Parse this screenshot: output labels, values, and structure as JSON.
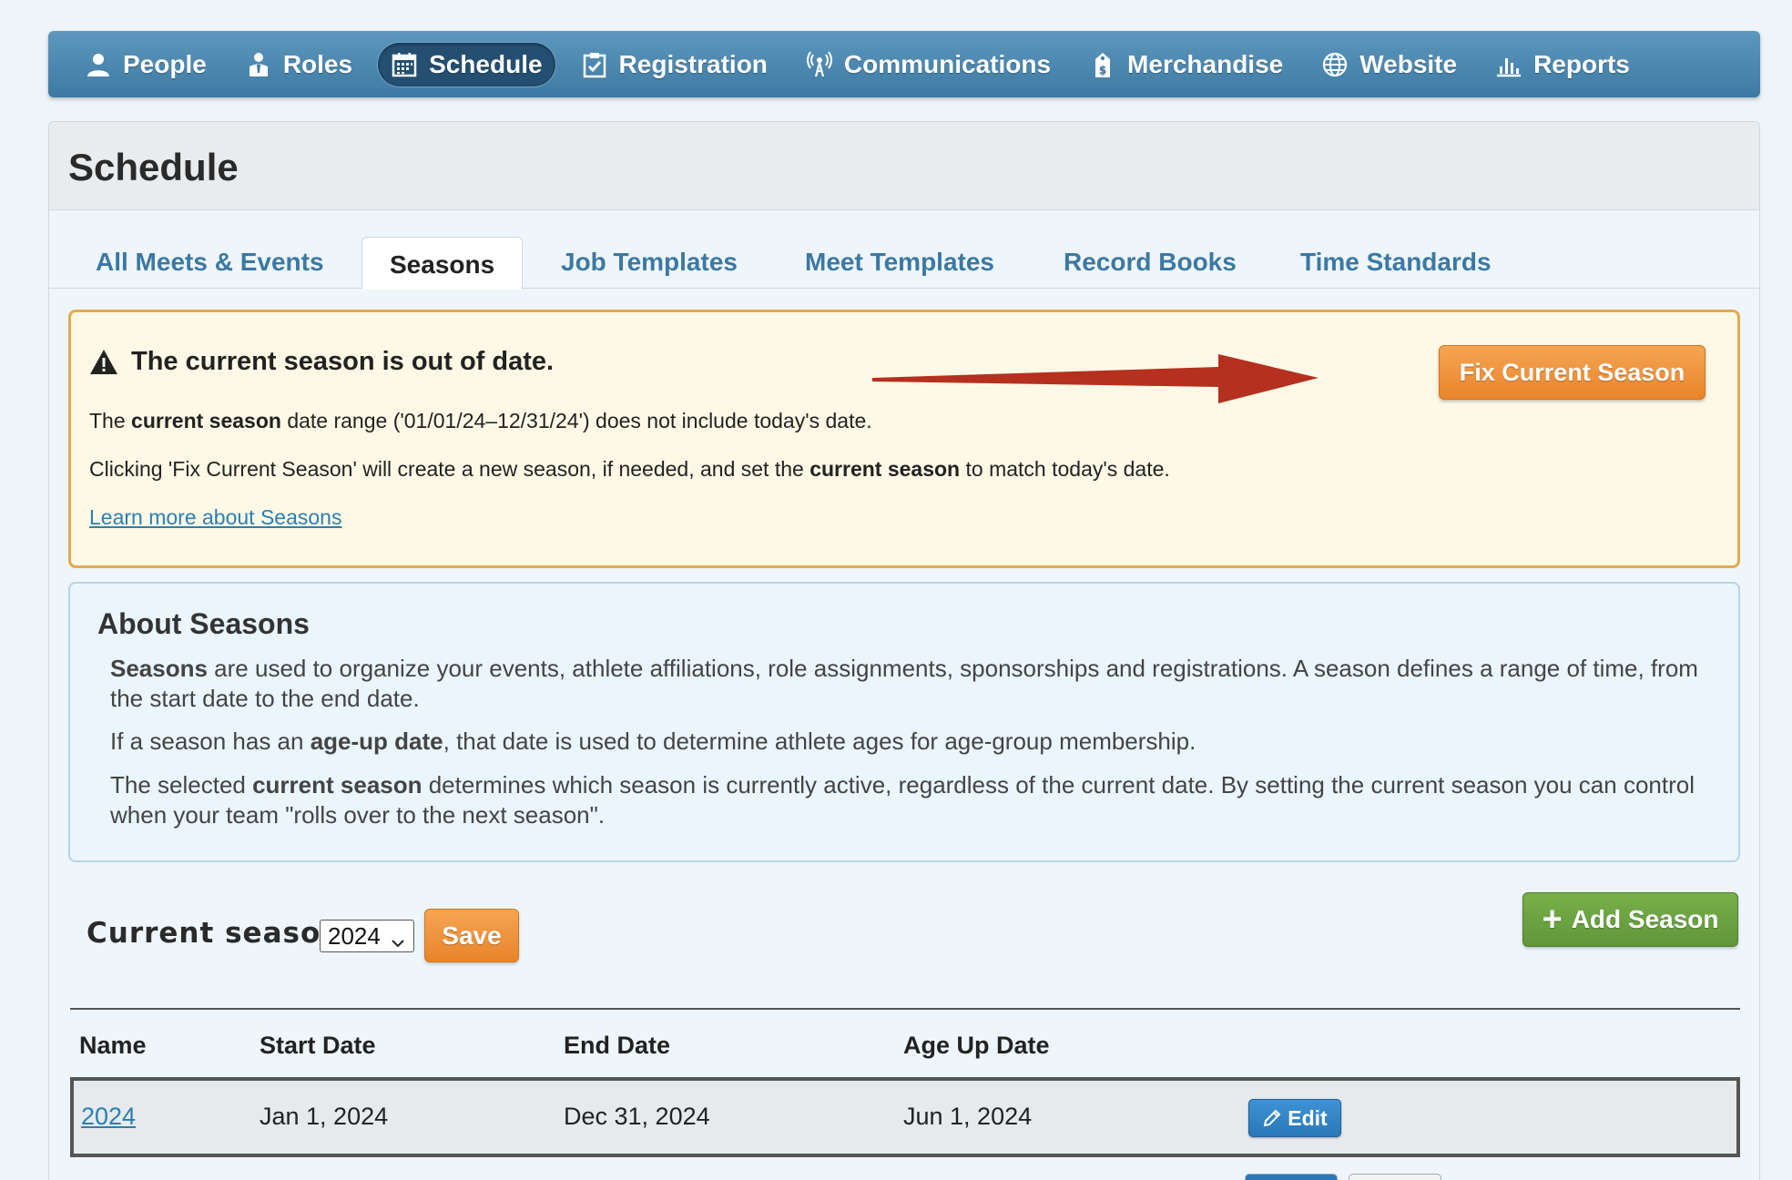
{
  "nav": {
    "items": [
      {
        "label": "People",
        "icon": "person-icon",
        "active": false
      },
      {
        "label": "Roles",
        "icon": "role-icon",
        "active": false
      },
      {
        "label": "Schedule",
        "icon": "calendar-icon",
        "active": true
      },
      {
        "label": "Registration",
        "icon": "clipboard-check-icon",
        "active": false
      },
      {
        "label": "Communications",
        "icon": "broadcast-icon",
        "active": false
      },
      {
        "label": "Merchandise",
        "icon": "price-tag-icon",
        "active": false
      },
      {
        "label": "Website",
        "icon": "globe-icon",
        "active": false
      },
      {
        "label": "Reports",
        "icon": "bar-chart-icon",
        "active": false
      }
    ]
  },
  "page": {
    "title": "Schedule"
  },
  "tabs": [
    {
      "label": "All Meets & Events",
      "active": false
    },
    {
      "label": "Seasons",
      "active": true
    },
    {
      "label": "Job Templates",
      "active": false
    },
    {
      "label": "Meet Templates",
      "active": false
    },
    {
      "label": "Record Books",
      "active": false
    },
    {
      "label": "Time Standards",
      "active": false
    }
  ],
  "alert": {
    "heading": "The current season is out of date.",
    "line1_pre": "The ",
    "line1_bold": "current season",
    "line1_post": " date range ('01/01/24–12/31/24') does not include today's date.",
    "line2_pre": "Clicking 'Fix Current Season' will create a new season, if needed, and set the ",
    "line2_bold": "current season",
    "line2_post": " to match today's date.",
    "link": "Learn more about Seasons",
    "fix_button": "Fix Current Season",
    "accent_color": "#e5a94b",
    "arrow_color": "#b5301f"
  },
  "about": {
    "title": "About Seasons",
    "p1_bold": "Seasons",
    "p1_rest": " are used to organize your events, athlete affiliations, role assignments, sponsorships and registrations. A season defines a range of time, from the start date to the end date.",
    "p2_pre": "If a season has an ",
    "p2_bold": "age-up date",
    "p2_post": ", that date is used to determine athlete ages for age-group membership.",
    "p3_pre": "The selected ",
    "p3_bold": "current season",
    "p3_post": " determines which season is currently active, regardless of the current date. By setting the current season you can control when your team \"rolls over to the next season\"."
  },
  "current_season": {
    "label": "Current season:",
    "selected": "2024",
    "save_button": "Save",
    "add_button": "Add Season"
  },
  "table": {
    "headers": [
      "Name",
      "Start Date",
      "End Date",
      "Age Up Date"
    ],
    "rows": [
      {
        "name": "2024",
        "start": "Jan 1, 2024",
        "end": "Dec 31, 2024",
        "age_up": "Jun 1, 2024",
        "edit": "Edit"
      }
    ]
  }
}
